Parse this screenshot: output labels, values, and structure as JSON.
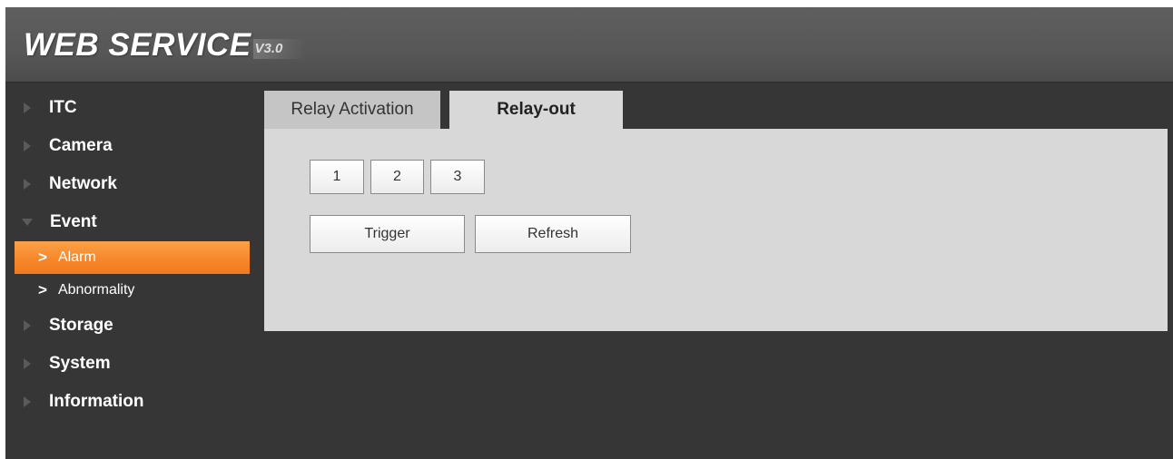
{
  "app": {
    "logo_main": "WEB SERVICE",
    "logo_version": "V3.0"
  },
  "sidebar": {
    "items": [
      {
        "label": "ITC",
        "expanded": false
      },
      {
        "label": "Camera",
        "expanded": false
      },
      {
        "label": "Network",
        "expanded": false
      },
      {
        "label": "Event",
        "expanded": true
      },
      {
        "label": "Storage",
        "expanded": false
      },
      {
        "label": "System",
        "expanded": false
      },
      {
        "label": "Information",
        "expanded": false
      }
    ],
    "event_subitems": [
      {
        "label": "Alarm",
        "active": true
      },
      {
        "label": "Abnormality",
        "active": false
      }
    ],
    "chevron": ">"
  },
  "tabs": [
    {
      "label": "Relay Activation",
      "active": false
    },
    {
      "label": "Relay-out",
      "active": true
    }
  ],
  "relay_buttons": [
    "1",
    "2",
    "3"
  ],
  "actions": {
    "trigger_label": "Trigger",
    "refresh_label": "Refresh"
  },
  "colors": {
    "background": "#363636",
    "header": "#575757",
    "active_accent": "#f7872a",
    "panel": "#d8d8d8"
  }
}
